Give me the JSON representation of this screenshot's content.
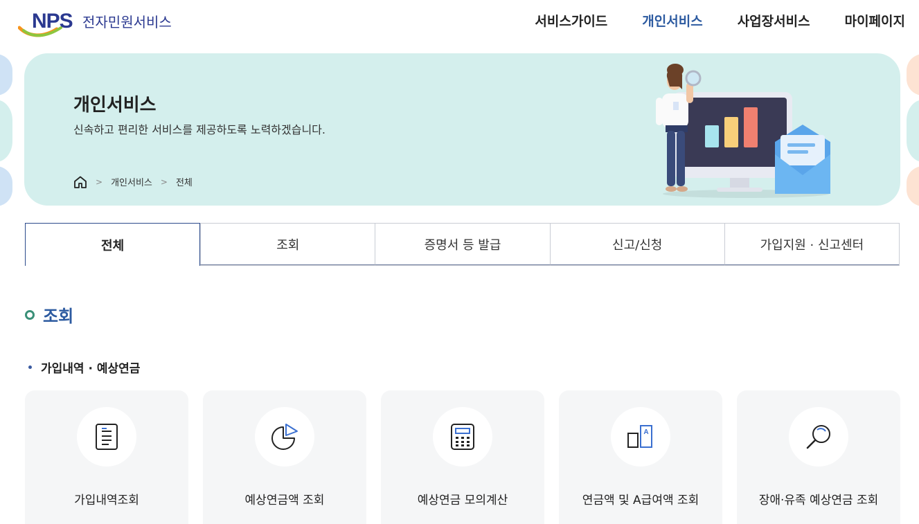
{
  "header": {
    "logo_mark": "NPS",
    "logo_text": "전자민원서비스",
    "nav": [
      {
        "label": "서비스가이드",
        "active": false
      },
      {
        "label": "개인서비스",
        "active": true
      },
      {
        "label": "사업장서비스",
        "active": false
      },
      {
        "label": "마이페이지",
        "active": false
      }
    ]
  },
  "banner": {
    "title": "개인서비스",
    "subtitle": "신속하고 편리한 서비스를 제공하도록 노력하겠습니다.",
    "breadcrumb": [
      "개인서비스",
      "전체"
    ]
  },
  "tabs": [
    {
      "label": "전체",
      "active": true
    },
    {
      "label": "조회",
      "active": false
    },
    {
      "label": "증명서 등 발급",
      "active": false
    },
    {
      "label": "신고/신청",
      "active": false
    },
    {
      "label": "가입지원 · 신고센터",
      "active": false
    }
  ],
  "section": {
    "title": "조회",
    "subsection": "가입내역 · 예상연금"
  },
  "cards": [
    {
      "label": "가입내역조회",
      "icon": "document-icon"
    },
    {
      "label": "예상연금액 조회",
      "icon": "pie-chart-icon"
    },
    {
      "label": "예상연금 모의계산",
      "icon": "calculator-icon"
    },
    {
      "label": "연금액 및 A급여액 조회",
      "icon": "a-grade-icon"
    },
    {
      "label": "장애·유족 예상연금 조회",
      "icon": "magnifier-icon"
    }
  ],
  "colors": {
    "brand": "#2b3990",
    "accent": "#2c5aa0",
    "banner_bg": "#d4efed",
    "section_dot": "#3a9078"
  }
}
